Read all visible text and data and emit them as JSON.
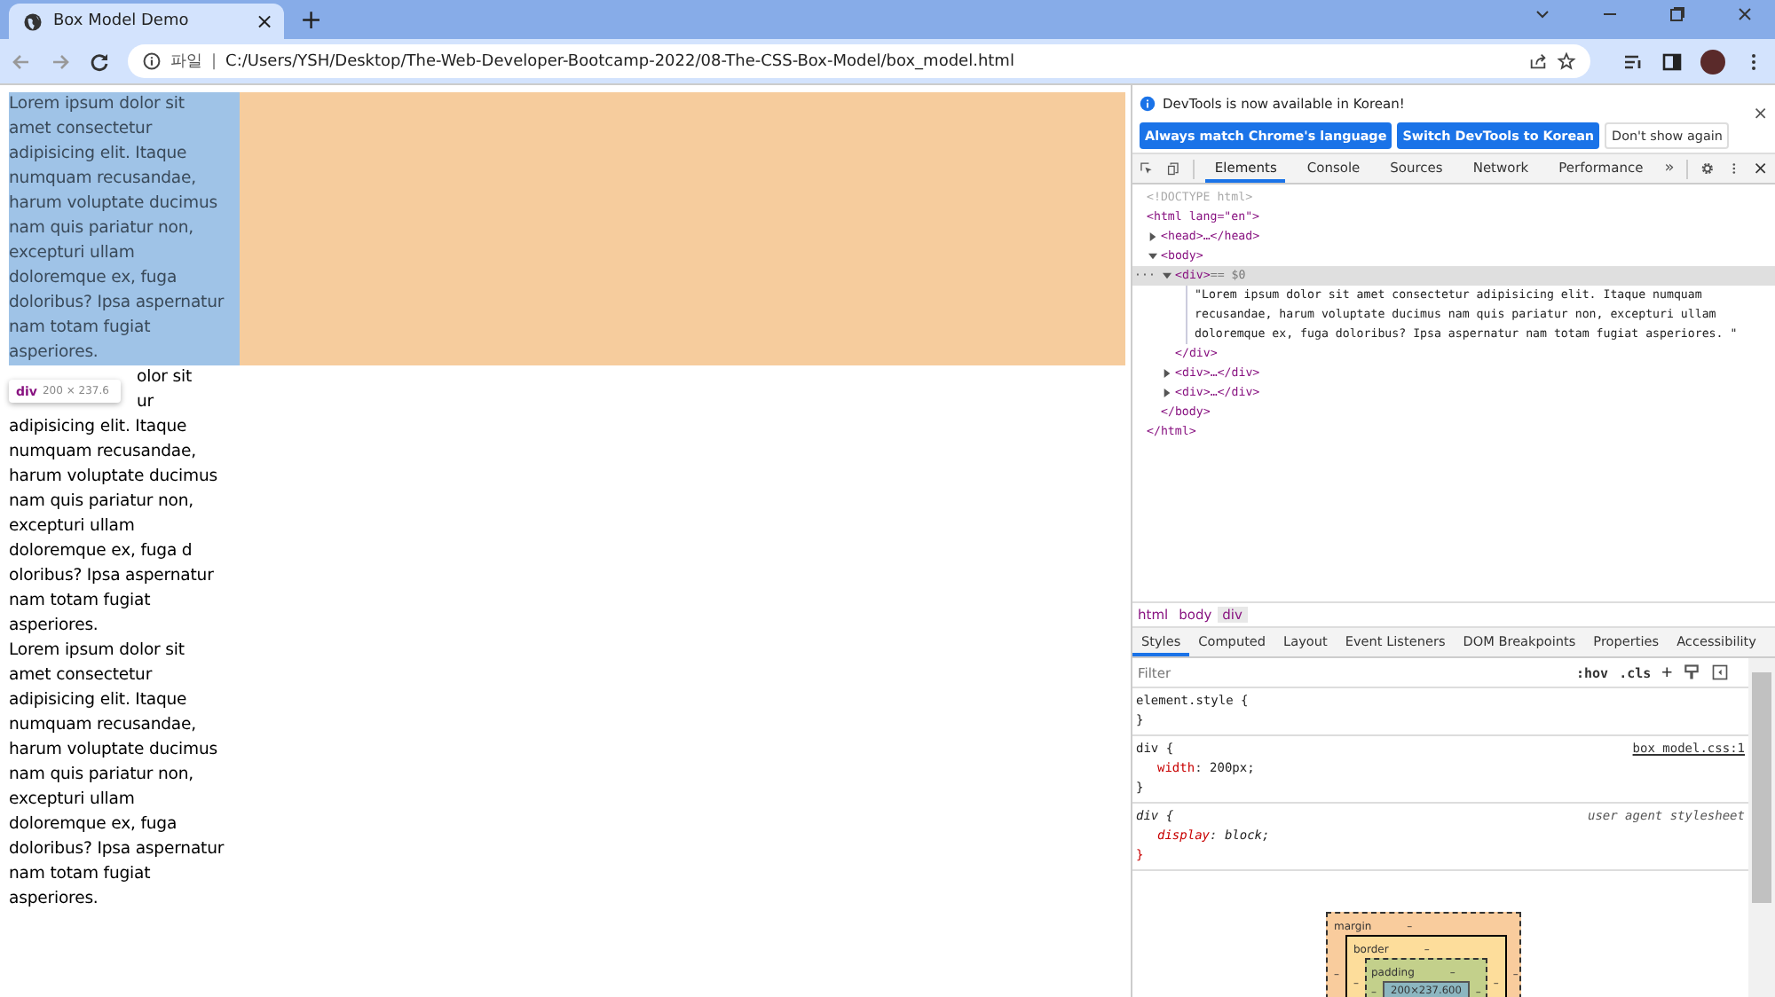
{
  "browser": {
    "tab": {
      "title": "Box Model Demo",
      "close": "×"
    },
    "new_tab": "+",
    "address": {
      "scheme_label": "파일",
      "separator": "|",
      "url": "C:/Users/YSH/Desktop/The-Web-Developer-Bootcamp-2022/08-The-CSS-Box-Model/box_model.html"
    }
  },
  "page": {
    "paragraphs": [
      {
        "highlighted": true,
        "lines": [
          {
            "text": "Lorem ipsum dolor sit",
            "kind": "full"
          },
          {
            "text": "amet consectetur",
            "kind": "full"
          },
          {
            "text": "adipisicing elit. Itaque",
            "kind": "full"
          },
          {
            "text": "numquam recusandae,",
            "kind": "full"
          },
          {
            "text": "harum voluptate ducimus",
            "kind": "full"
          },
          {
            "text": "nam quis pariatur non,",
            "kind": "full"
          },
          {
            "text": "excepturi ullam",
            "kind": "full"
          },
          {
            "text": "doloremque ex, fuga",
            "kind": "full"
          },
          {
            "text": "doloribus? Ipsa aspernatur",
            "kind": "full"
          },
          {
            "text": "nam totam fugiat",
            "kind": "full"
          },
          {
            "text": "asperiores.",
            "kind": "full"
          }
        ]
      },
      {
        "highlighted": false,
        "lines": [
          {
            "text": "olor sit",
            "kind": "partial"
          },
          {
            "text": "ur",
            "kind": "partial"
          },
          {
            "text": "adipisicing elit. Itaque",
            "kind": "full"
          },
          {
            "text": "numquam recusandae,",
            "kind": "full"
          },
          {
            "text": "harum voluptate ducimus",
            "kind": "full"
          },
          {
            "text": "nam quis pariatur non,",
            "kind": "full"
          },
          {
            "text": "excepturi ullam",
            "kind": "full"
          },
          {
            "text": "doloremque ex, fuga d",
            "kind": "full"
          },
          {
            "text": "oloribus? Ipsa aspernatur",
            "kind": "full"
          },
          {
            "text": "nam totam fugiat",
            "kind": "full"
          },
          {
            "text": "asperiores.",
            "kind": "full"
          }
        ]
      },
      {
        "highlighted": false,
        "lines": [
          {
            "text": "Lorem ipsum dolor sit",
            "kind": "full"
          },
          {
            "text": "amet consectetur",
            "kind": "full"
          },
          {
            "text": "adipisicing elit. Itaque",
            "kind": "full"
          },
          {
            "text": "numquam recusandae,",
            "kind": "full"
          },
          {
            "text": "harum voluptate ducimus",
            "kind": "full"
          },
          {
            "text": "nam quis pariatur non,",
            "kind": "full"
          },
          {
            "text": "excepturi ullam",
            "kind": "full"
          },
          {
            "text": "doloremque ex, fuga",
            "kind": "full"
          },
          {
            "text": "doloribus? Ipsa aspernatur",
            "kind": "full"
          },
          {
            "text": "nam totam fugiat",
            "kind": "full"
          },
          {
            "text": "asperiores.",
            "kind": "full"
          }
        ]
      }
    ],
    "tooltip": {
      "tag": "div",
      "size": "200 × 237.6"
    }
  },
  "devtools": {
    "infobar": {
      "message": "DevTools is now available in Korean!",
      "close": "×",
      "buttons": [
        {
          "label": "Always match Chrome's language",
          "kind": "primary"
        },
        {
          "label": "Switch DevTools to Korean",
          "kind": "primary"
        },
        {
          "label": "Don't show again",
          "kind": "plain"
        }
      ]
    },
    "tabs": [
      {
        "label": "Elements",
        "selected": true
      },
      {
        "label": "Console",
        "selected": false
      },
      {
        "label": "Sources",
        "selected": false
      },
      {
        "label": "Network",
        "selected": false
      },
      {
        "label": "Performance",
        "selected": false
      }
    ],
    "more_tabs": "»",
    "close": "×",
    "dom": [
      {
        "text": "<!DOCTYPE html>",
        "kind": "doctype"
      },
      {
        "text": "<html lang=\"en\">",
        "kind": "tag",
        "close": "</html>",
        "children": [
          {
            "text": "<head>…</head>",
            "kind": "tag",
            "expanded": false
          },
          {
            "text": "<body>",
            "kind": "tag",
            "expanded": true,
            "close": "</body>",
            "children": [
              {
                "text": "<div>",
                "kind": "tag",
                "expanded": true,
                "selected": true,
                "gutter": "···",
                "marker": "== $0",
                "close": "</div>",
                "children": [
                  {
                    "text": "\"Lorem ipsum dolor sit amet consectetur adipisicing elit. Itaque numquam recusandae, harum voluptate ducimus nam quis pariatur non, excepturi ullam doloremque ex, fuga doloribus? Ipsa aspernatur nam totam fugiat asperiores. \"",
                    "kind": "text"
                  }
                ]
              },
              {
                "text": "<div>…</div>",
                "kind": "tag",
                "expanded": false,
                "selected": false
              },
              {
                "text": "<div>…</div>",
                "kind": "tag",
                "expanded": false,
                "selected": false
              }
            ]
          }
        ]
      }
    ],
    "breadcrumbs": [
      {
        "label": "html",
        "selected": false
      },
      {
        "label": "body",
        "selected": false
      },
      {
        "label": "div",
        "selected": true
      }
    ],
    "style_tabs": [
      {
        "label": "Styles",
        "selected": true
      },
      {
        "label": "Computed",
        "selected": false
      },
      {
        "label": "Layout",
        "selected": false
      },
      {
        "label": "Event Listeners",
        "selected": false
      },
      {
        "label": "DOM Breakpoints",
        "selected": false
      },
      {
        "label": "Properties",
        "selected": false
      },
      {
        "label": "Accessibility",
        "selected": false
      }
    ],
    "filter": {
      "placeholder": "Filter"
    },
    "hov": ":hov",
    "cls": ".cls",
    "add": "+",
    "rules": [
      {
        "selector": "element.style {",
        "close": "}",
        "kind": "inline"
      },
      {
        "selector": "div {",
        "source": "box_model.css:1",
        "close": "}",
        "kind": "author",
        "declarations": [
          {
            "property": "width",
            "colon": ":",
            "value": "200px;"
          }
        ]
      },
      {
        "selector": "div {",
        "source": "user agent stylesheet",
        "close": "}",
        "kind": "user-agent",
        "declarations": [
          {
            "property": "display",
            "colon": ":",
            "value": "block;"
          }
        ]
      }
    ],
    "box_model": {
      "margin": {
        "label": "margin",
        "top": "–",
        "left": "–",
        "right": "–"
      },
      "border": {
        "label": "border",
        "top": "–",
        "left": "–",
        "right": "–"
      },
      "padding": {
        "label": "padding",
        "top": "–",
        "left": "–",
        "right": "–"
      },
      "content": "200×237.600"
    }
  }
}
